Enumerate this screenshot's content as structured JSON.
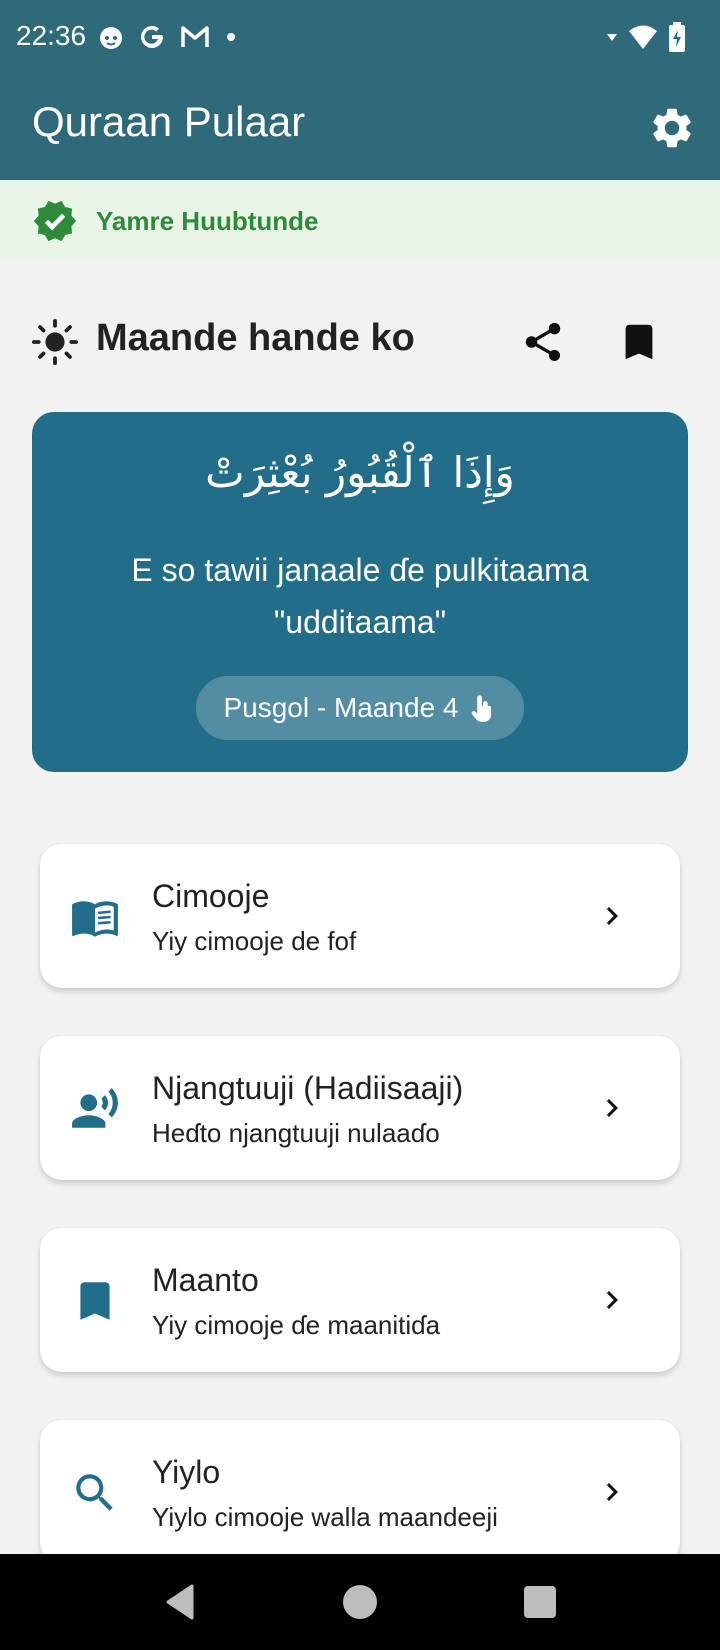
{
  "status_bar": {
    "time": "22:36",
    "icons": [
      "cat-notification-icon",
      "google-icon",
      "gmail-icon",
      "dot-icon",
      "wifi-icon",
      "battery-charging-icon"
    ]
  },
  "app_bar": {
    "title": "Quraan Pulaar",
    "settings_icon": "gear-icon"
  },
  "verified_banner": {
    "text": "Yamre Huubtunde",
    "color": "#2e8b3a",
    "background": "#e8f5e6"
  },
  "verse_of_day": {
    "heading": "Maande hande ko",
    "arabic": "وَإِذَا ٱلْقُبُورُ بُعْثِرَتْ",
    "translation": "E so tawii janaale ɗe pulkitaama \"udditaama\"",
    "reference": "Pusgol - Maande 4",
    "card_color": "#226d8a"
  },
  "menu": [
    {
      "title": "Cimooje",
      "subtitle": "Yiy cimooje de fof",
      "icon": "book-icon"
    },
    {
      "title": "Njangtuuji (Hadiisaaji)",
      "subtitle": "Heɗto njangtuuji nulaaɗo",
      "icon": "speaking-person-icon"
    },
    {
      "title": "Maanto",
      "subtitle": "Yiy cimooje ɗe maanitiɗa",
      "icon": "bookmark-icon"
    },
    {
      "title": "Yiylo",
      "subtitle": "Yiylo cimooje walla maandeeji",
      "icon": "search-icon"
    }
  ],
  "theme": {
    "primary": "#2e6a7a",
    "accent": "#226d8a"
  }
}
